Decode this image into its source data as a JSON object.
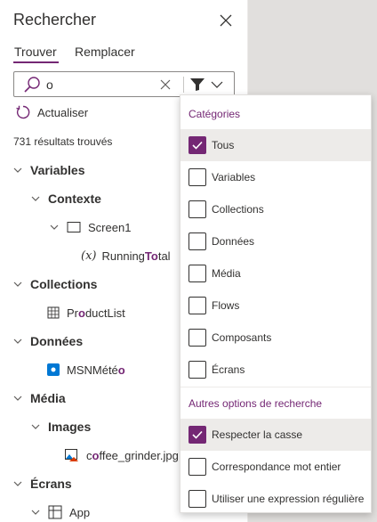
{
  "panel": {
    "title": "Rechercher",
    "tabs": [
      {
        "label": "Trouver",
        "active": true
      },
      {
        "label": "Remplacer",
        "active": false
      }
    ],
    "search": {
      "value": "o",
      "placeholder": ""
    },
    "refresh_label": "Actualiser",
    "results_count": "731 résultats trouvés"
  },
  "tree": {
    "variables": "Variables",
    "contexte": "Contexte",
    "screen1": "Screen1",
    "running_total": {
      "pre": "Running",
      "hl": "To",
      "post": "tal"
    },
    "collections": "Collections",
    "product_list": {
      "pre": "Pr",
      "hl": "o",
      "post": "ductList"
    },
    "donnees": "Données",
    "msn": {
      "pre": "MSNMété",
      "hl": "o",
      "post": ""
    },
    "media": "Média",
    "images": "Images",
    "coffee": {
      "pre": "c",
      "hl": "o",
      "post": "ffee_grinder.jpg"
    },
    "ecrans": "Écrans",
    "app": "App"
  },
  "filter_menu": {
    "categories_header": "Catégories",
    "categories": [
      {
        "label": "Tous",
        "checked": true
      },
      {
        "label": "Variables",
        "checked": false
      },
      {
        "label": "Collections",
        "checked": false
      },
      {
        "label": "Données",
        "checked": false
      },
      {
        "label": "Média",
        "checked": false
      },
      {
        "label": "Flows",
        "checked": false
      },
      {
        "label": "Composants",
        "checked": false
      },
      {
        "label": "Écrans",
        "checked": false
      }
    ],
    "options_header": "Autres options de recherche",
    "options": [
      {
        "label": "Respecter la casse",
        "checked": true
      },
      {
        "label": "Correspondance mot entier",
        "checked": false
      },
      {
        "label": "Utiliser une expression régulière",
        "checked": false
      }
    ]
  },
  "colors": {
    "accent": "#742774",
    "selected_bg": "#edebe9"
  }
}
